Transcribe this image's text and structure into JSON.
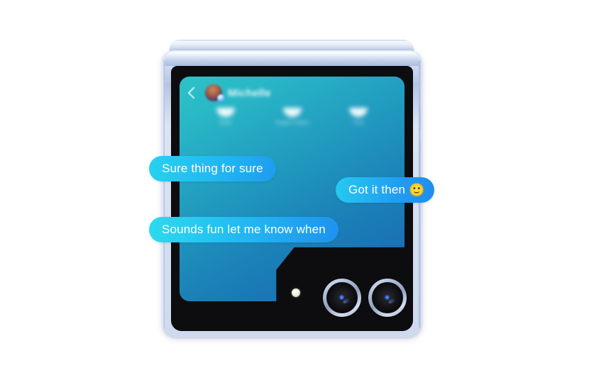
{
  "scene": {
    "description": "Folded smartphone cover-screen chat",
    "background_color": "#ffffff"
  },
  "device": {
    "name": "foldable-flip-phone",
    "frame_color": "#c6d3ea",
    "glass_color": "#0d0d10"
  },
  "app": {
    "surface_gradient_from": "#2dc3c7",
    "surface_gradient_to": "#2060bb",
    "header": {
      "back_icon": "chevron-left-icon",
      "avatar_icon": "contact-avatar",
      "status_badge_icon": "online-badge-icon",
      "contact_name": "Michelle"
    },
    "quick_actions": [
      {
        "icon": "reply-icon",
        "label": "Reply"
      },
      {
        "icon": "suggest-replies-icon",
        "label": "Suggest replies"
      },
      {
        "icon": "clear-icon",
        "label": "Clear"
      }
    ],
    "messages": [
      {
        "id": "msg-0",
        "text": "Sure thing for sure",
        "emoji": "",
        "side": "incoming",
        "gradient_from": "#26d2ef",
        "gradient_to": "#1f9bf0"
      },
      {
        "id": "msg-1",
        "text": "Got it then",
        "emoji": "🙂",
        "side": "outgoing",
        "gradient_from": "#26cbf0",
        "gradient_to": "#1d8ef0"
      },
      {
        "id": "msg-2",
        "text": "Sounds fun let me know when",
        "emoji": "",
        "side": "incoming",
        "gradient_from": "#2bdcee",
        "gradient_to": "#1e92ef"
      }
    ]
  },
  "hardware": {
    "flash_icon": "camera-flash-led",
    "lenses": [
      {
        "name": "main-camera-lens"
      },
      {
        "name": "secondary-camera-lens"
      }
    ],
    "buttons": [
      {
        "name": "power-button"
      },
      {
        "name": "volume-button"
      }
    ]
  }
}
